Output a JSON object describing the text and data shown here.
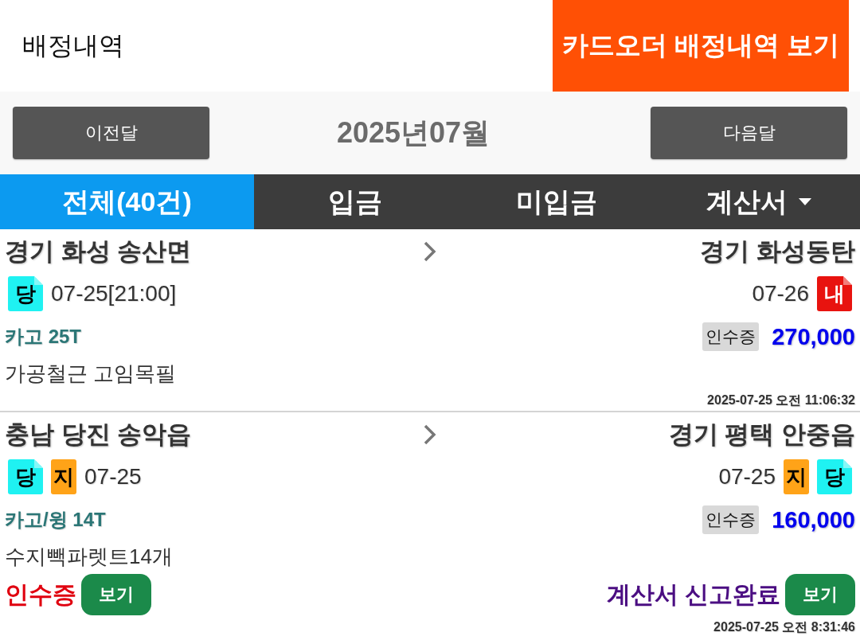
{
  "header": {
    "title": "배정내역",
    "card_order_button": "카드오더 배정내역 보기"
  },
  "month_nav": {
    "prev_button": "이전달",
    "month": "2025년07월",
    "next_button": "다음달"
  },
  "tabs": [
    {
      "label": "전체(40건)",
      "selected": true,
      "kind": "tab"
    },
    {
      "label": "입금",
      "selected": false,
      "kind": "tab"
    },
    {
      "label": "미입금",
      "selected": false,
      "kind": "tab"
    },
    {
      "label": "계산서",
      "selected": false,
      "kind": "dropdown"
    }
  ],
  "orders": [
    {
      "origin": {
        "address": "**경기** 화성 송산면",
        "badges": [
          {
            "label": "당",
            "kind": "folded",
            "color": "#1ff2f2"
          }
        ],
        "date": "07-25[21:00]"
      },
      "destination": {
        "address": "**경기** 화성동탄",
        "date": "07-26",
        "badges": [
          {
            "label": "내",
            "kind": "folded",
            "color": "#e8130f"
          }
        ]
      },
      "vehicle": "카고 25T",
      "receipt_tag": "인수증",
      "amount": "270,000",
      "cargo": "가공철근 고임목필",
      "timestamp": "2025-07-25 오전 11:06:32"
    },
    {
      "origin": {
        "address": "**충남** 당진 송악읍",
        "badges": [
          {
            "label": "당",
            "kind": "folded",
            "color": "#1ff2f2"
          },
          {
            "label": "지",
            "kind": "plain",
            "color": "#ffa318"
          }
        ],
        "date": "07-25"
      },
      "destination": {
        "address": "**경기** 평택 안중읍",
        "date": "07-25",
        "badges": [
          {
            "label": "지",
            "kind": "plain",
            "color": "#ffa318"
          },
          {
            "label": "당",
            "kind": "folded",
            "color": "#1ff2f2"
          }
        ]
      },
      "vehicle": "카고/윙 14T",
      "receipt_tag": "인수증",
      "amount": "160,000",
      "cargo": "수지빽파렛트14개",
      "receipt_status": {
        "label": "인수증",
        "button": "보기"
      },
      "invoice_status": {
        "label": "계산서 신고완료",
        "button": "보기"
      },
      "timestamp": "2025-07-25 오전 8:31:46"
    }
  ]
}
